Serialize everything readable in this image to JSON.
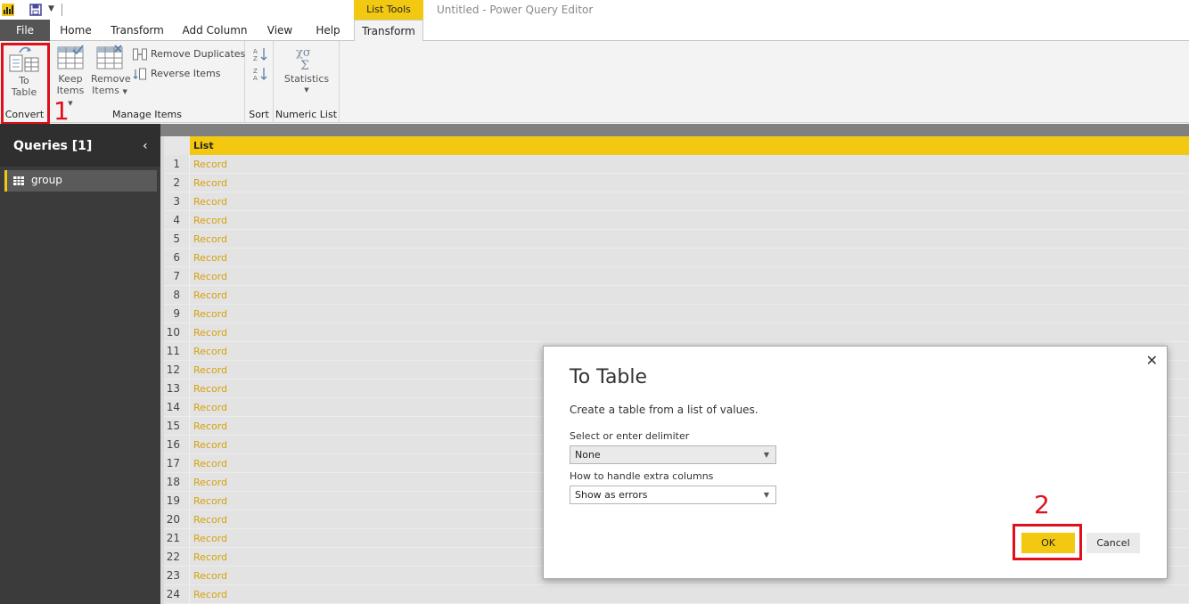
{
  "titlebar": {
    "context_tab": "List Tools",
    "window_title": "Untitled - Power Query Editor"
  },
  "tabs": [
    "File",
    "Home",
    "Transform",
    "Add Column",
    "View",
    "Help",
    "Transform"
  ],
  "ribbon": {
    "convert": {
      "button_line1": "To",
      "button_line2": "Table",
      "group_label": "Convert"
    },
    "manage_items": {
      "keep_line1": "Keep",
      "keep_line2": "Items",
      "remove_line1": "Remove",
      "remove_line2": "Items",
      "remove_duplicates": "Remove Duplicates",
      "reverse_items": "Reverse Items",
      "group_label": "Manage Items"
    },
    "sort": {
      "group_label": "Sort"
    },
    "numeric_list": {
      "statistics": "Statistics",
      "group_label": "Numeric List"
    }
  },
  "annotations": {
    "step1": "1",
    "step2": "2"
  },
  "queries_pane": {
    "title": "Queries [1]",
    "items": [
      "group"
    ]
  },
  "grid": {
    "column_header": "List",
    "rows": [
      {
        "n": "1",
        "v": "Record"
      },
      {
        "n": "2",
        "v": "Record"
      },
      {
        "n": "3",
        "v": "Record"
      },
      {
        "n": "4",
        "v": "Record"
      },
      {
        "n": "5",
        "v": "Record"
      },
      {
        "n": "6",
        "v": "Record"
      },
      {
        "n": "7",
        "v": "Record"
      },
      {
        "n": "8",
        "v": "Record"
      },
      {
        "n": "9",
        "v": "Record"
      },
      {
        "n": "10",
        "v": "Record"
      },
      {
        "n": "11",
        "v": "Record"
      },
      {
        "n": "12",
        "v": "Record"
      },
      {
        "n": "13",
        "v": "Record"
      },
      {
        "n": "14",
        "v": "Record"
      },
      {
        "n": "15",
        "v": "Record"
      },
      {
        "n": "16",
        "v": "Record"
      },
      {
        "n": "17",
        "v": "Record"
      },
      {
        "n": "18",
        "v": "Record"
      },
      {
        "n": "19",
        "v": "Record"
      },
      {
        "n": "20",
        "v": "Record"
      },
      {
        "n": "21",
        "v": "Record"
      },
      {
        "n": "22",
        "v": "Record"
      },
      {
        "n": "23",
        "v": "Record"
      },
      {
        "n": "24",
        "v": "Record"
      }
    ]
  },
  "dialog": {
    "title": "To Table",
    "description": "Create a table from a list of values.",
    "delimiter_label": "Select or enter delimiter",
    "delimiter_value": "None",
    "extra_columns_label": "How to handle extra columns",
    "extra_columns_value": "Show as errors",
    "ok_label": "OK",
    "cancel_label": "Cancel"
  },
  "colors": {
    "accent": "#f2c811",
    "annotation_red": "#e0101b",
    "pane_dark": "#3b3b3b"
  }
}
